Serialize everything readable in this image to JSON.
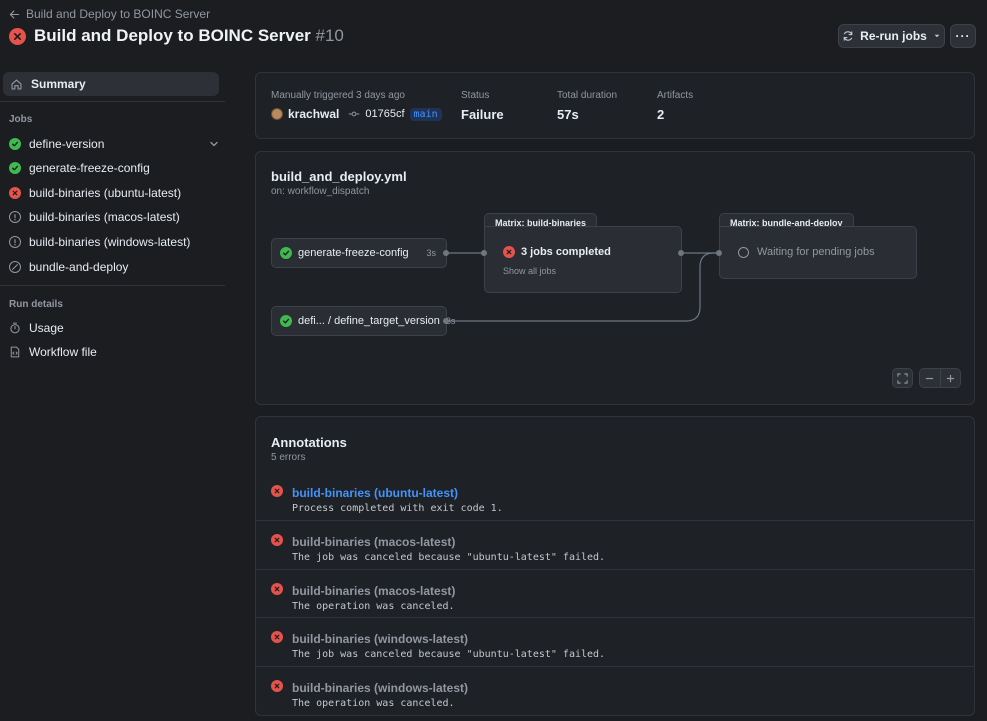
{
  "header": {
    "back_label": "Build and Deploy to BOINC Server",
    "title": "Build and Deploy to BOINC Server",
    "run_number": "#10",
    "rerun_label": "Re-run jobs",
    "more_label": "···"
  },
  "sidebar": {
    "summary_label": "Summary",
    "jobs_heading": "Jobs",
    "jobs": [
      {
        "label": "define-version",
        "status": "success"
      },
      {
        "label": "generate-freeze-config",
        "status": "success"
      },
      {
        "label": "build-binaries (ubuntu-latest)",
        "status": "failure"
      },
      {
        "label": "build-binaries (macos-latest)",
        "status": "cancelled"
      },
      {
        "label": "build-binaries (windows-latest)",
        "status": "cancelled"
      },
      {
        "label": "bundle-and-deploy",
        "status": "skipped"
      }
    ],
    "run_details_heading": "Run details",
    "usage_label": "Usage",
    "workflow_file_label": "Workflow file"
  },
  "summary": {
    "trigger_text": "Manually triggered 3 days ago",
    "actor": "krachwal",
    "commit": "01765cf",
    "branch": "main",
    "status_label": "Status",
    "status_value": "Failure",
    "duration_label": "Total duration",
    "duration_value": "57s",
    "artifacts_label": "Artifacts",
    "artifacts_value": "2"
  },
  "graph": {
    "file_name": "build_and_deploy.yml",
    "trigger": "on: workflow_dispatch",
    "node_generate": {
      "label": "generate-freeze-config",
      "time": "3s"
    },
    "node_define": {
      "label": "defi... / define_target_version",
      "time": "3s"
    },
    "matrix_build": {
      "tab": "Matrix: build-binaries",
      "status": "3 jobs completed",
      "link": "Show all jobs"
    },
    "matrix_deploy": {
      "tab": "Matrix: bundle-and-deploy",
      "status": "Waiting for pending jobs"
    }
  },
  "annotations": {
    "title": "Annotations",
    "count": "5 errors",
    "items": [
      {
        "title": "build-binaries (ubuntu-latest)",
        "message": "Process completed with exit code 1."
      },
      {
        "title": "build-binaries (macos-latest)",
        "message": "The job was canceled because \"ubuntu-latest\" failed."
      },
      {
        "title": "build-binaries (macos-latest)",
        "message": "The operation was canceled."
      },
      {
        "title": "build-binaries (windows-latest)",
        "message": "The job was canceled because \"ubuntu-latest\" failed."
      },
      {
        "title": "build-binaries (windows-latest)",
        "message": "The operation was canceled."
      }
    ]
  },
  "colors": {
    "background": "#1b1d21",
    "success": "#3fb950",
    "failure": "#e5534b",
    "link": "#4493f8"
  }
}
